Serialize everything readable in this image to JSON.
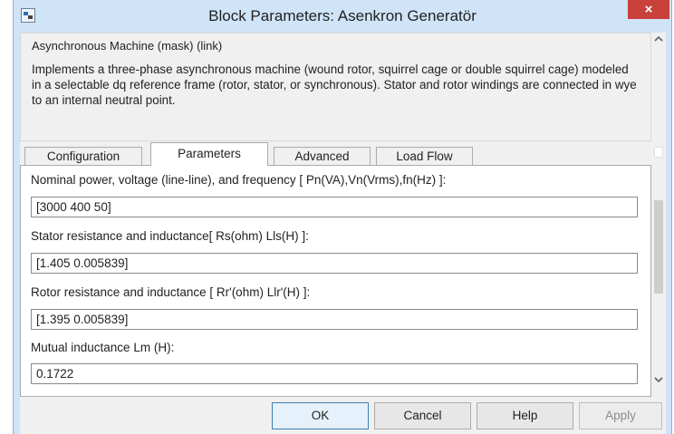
{
  "window": {
    "title": "Block Parameters: Asenkron Generatör",
    "close_glyph": "×"
  },
  "description": {
    "mask_title": "Asynchronous Machine (mask) (link)",
    "text": "Implements a three-phase asynchronous machine (wound rotor, squirrel cage or double squirrel cage) modeled in a selectable dq reference frame (rotor, stator, or synchronous). Stator and rotor windings are connected in wye to an internal neutral point."
  },
  "tabs": [
    {
      "label": "Configuration",
      "active": false
    },
    {
      "label": "Parameters",
      "active": true
    },
    {
      "label": "Advanced",
      "active": false
    },
    {
      "label": "Load Flow",
      "active": false
    }
  ],
  "params": [
    {
      "label": "Nominal power, voltage (line-line), and frequency [ Pn(VA),Vn(Vrms),fn(Hz) ]:",
      "value": "[3000 400 50]"
    },
    {
      "label": "Stator resistance and inductance[ Rs(ohm)  Lls(H) ]:",
      "value": "[1.405 0.005839]"
    },
    {
      "label": "Rotor resistance and inductance [ Rr'(ohm)  Llr'(H) ]:",
      "value": "[1.395 0.005839]"
    },
    {
      "label": "Mutual inductance Lm (H):",
      "value": "0.1722"
    }
  ],
  "buttons": {
    "ok": "OK",
    "cancel": "Cancel",
    "help": "Help",
    "apply": "Apply"
  },
  "colors": {
    "title_bar": "#cfe4f7",
    "close_button": "#c8413a",
    "default_button_border": "#3c7fb1"
  },
  "icons": {
    "app": "block-parameters-icon",
    "close": "close-icon",
    "scroll_up": "chevron-up-icon",
    "scroll_down": "chevron-down-icon"
  }
}
